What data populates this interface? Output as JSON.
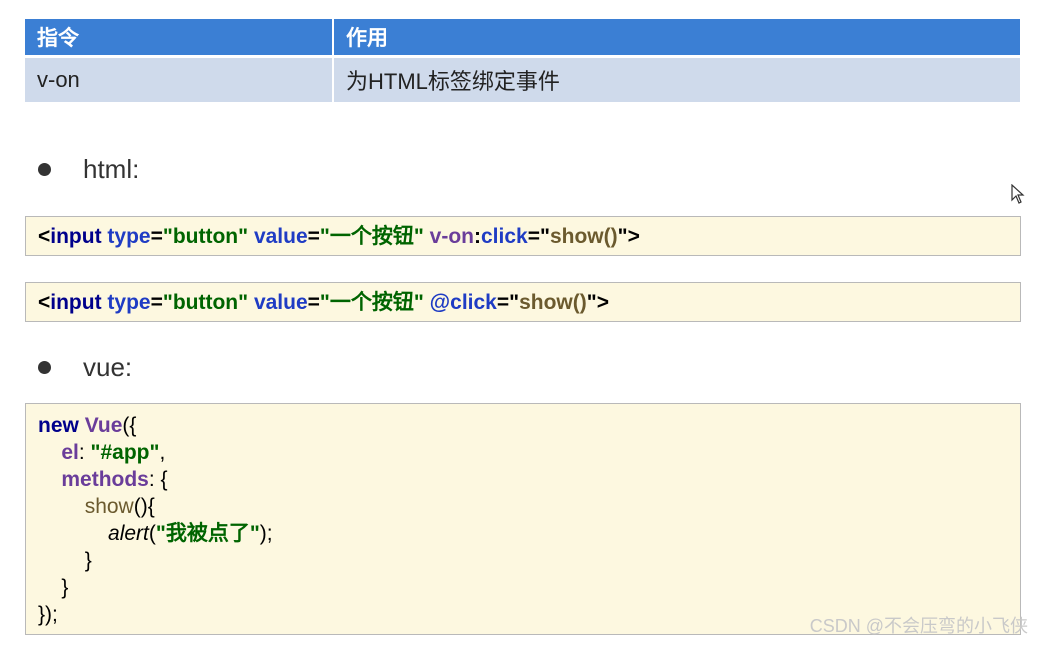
{
  "table": {
    "headers": [
      "指令",
      "作用"
    ],
    "row": [
      "v-on",
      "为HTML标签绑定事件"
    ]
  },
  "sections": {
    "html_label": "html:",
    "vue_label": "vue:"
  },
  "html_code": {
    "line1": {
      "lt": "<",
      "tag": "input",
      "a1": "type",
      "eq1": "=",
      "v1": "\"button\"",
      "a2": "value",
      "eq2": "=",
      "v2": "\"一个按钮\"",
      "a3a": "v-on",
      "a3b": ":",
      "a3c": "click",
      "eq3": "=",
      "q1": "\"",
      "v3": "show()",
      "q2": "\"",
      "gt": ">"
    },
    "line2": {
      "lt": "<",
      "tag": "input",
      "a1": "type",
      "eq1": "=",
      "v1": "\"button\"",
      "a2": "value",
      "eq2": "=",
      "v2": "\"一个按钮\"",
      "a3": "@click",
      "eq3": "=",
      "q1": "\"",
      "v3": "show()",
      "q2": "\"",
      "gt": ">"
    }
  },
  "vue_code": {
    "l1_kw": "new",
    "l1_cls": "Vue",
    "l1_rest": "({",
    "l2_prop": "el",
    "l2_colon": ": ",
    "l2_str": "\"#app\"",
    "l2_end": ",",
    "l3_prop": "methods",
    "l3_end": ": {",
    "l4_fn": "show",
    "l4_end": "(){",
    "l5_fn": "alert",
    "l5_open": "(",
    "l5_str": "\"我被点了\"",
    "l5_end": ");",
    "l6": "}",
    "l7": "}",
    "l8": "});"
  },
  "watermark": "CSDN @不会压弯的小飞侠"
}
